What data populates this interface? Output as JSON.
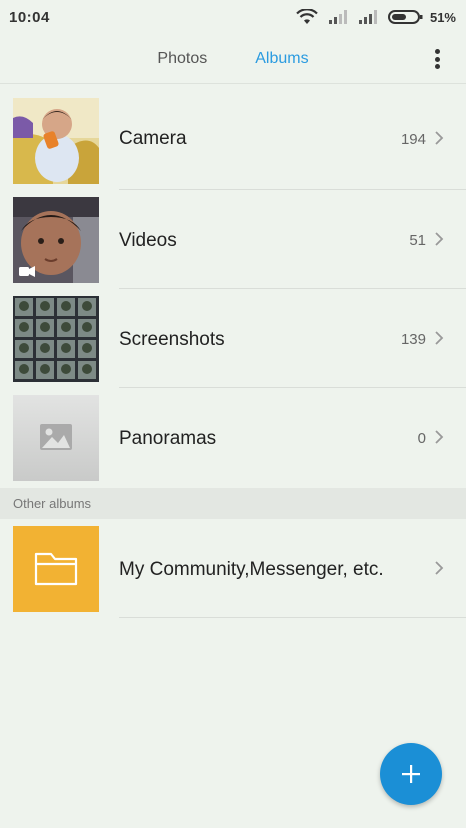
{
  "status_bar": {
    "time": "10:04",
    "battery_percent": "51%",
    "icons": [
      "wifi-icon",
      "signal-icon",
      "signal-icon",
      "battery-icon"
    ]
  },
  "tabs": [
    {
      "label": "Photos",
      "selected": false
    },
    {
      "label": "Albums",
      "selected": true
    }
  ],
  "colors": {
    "accent": "#2b9be0",
    "fab": "#1b8fd6",
    "folder": "#f2b233",
    "background": "#eef3ed"
  },
  "albums": [
    {
      "name": "Camera",
      "count": "194",
      "thumb": "photo-thumbnail"
    },
    {
      "name": "Videos",
      "count": "51",
      "thumb": "video-thumbnail"
    },
    {
      "name": "Screenshots",
      "count": "139",
      "thumb": "screenshots-thumbnail"
    },
    {
      "name": "Panoramas",
      "count": "0",
      "thumb": "image-placeholder-icon"
    }
  ],
  "other_albums": {
    "header": "Other albums",
    "items": [
      {
        "name": "My Community,Messenger, etc.",
        "thumb": "folder-icon"
      }
    ]
  },
  "fab": {
    "icon": "plus-icon"
  }
}
